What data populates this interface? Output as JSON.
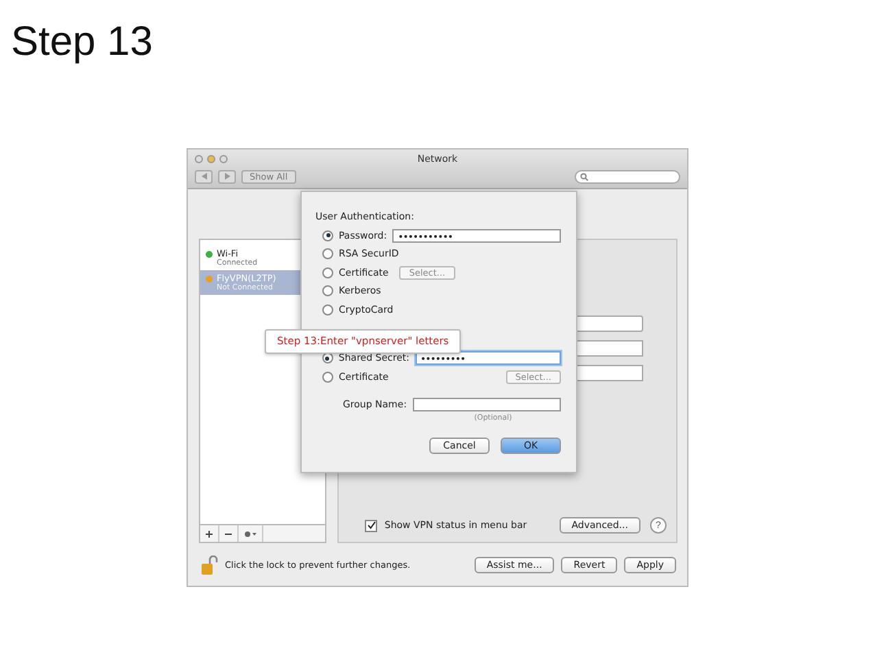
{
  "slide_title": "Step 13",
  "window": {
    "title": "Network",
    "show_all": "Show All"
  },
  "sidebar": {
    "items": [
      {
        "name": "Wi-Fi",
        "status": "Connected",
        "color": "#3cb043",
        "selected": false
      },
      {
        "name": "FlyVPN(L2TP)",
        "status": "Not Connected",
        "color": "#e8a020",
        "selected": true
      }
    ]
  },
  "vpn_status_checkbox": {
    "label": "Show VPN status in menu bar",
    "checked": true
  },
  "advanced_button": "Advanced...",
  "help_button": "?",
  "lock_text": "Click the lock to prevent further changes.",
  "footer_buttons": [
    "Assist me...",
    "Revert",
    "Apply"
  ],
  "sheet": {
    "heading": "User Authentication:",
    "groups": [
      [
        {
          "label": "Password:",
          "selected": true,
          "kind": "field",
          "value": "•••••••••••"
        },
        {
          "label": "RSA SecurID",
          "selected": false,
          "kind": "plain"
        },
        {
          "label": "Certificate",
          "selected": false,
          "kind": "button",
          "button": "Select..."
        },
        {
          "label": "Kerberos",
          "selected": false,
          "kind": "plain"
        },
        {
          "label": "CryptoCard",
          "selected": false,
          "kind": "plain"
        }
      ],
      [
        {
          "label": "Shared Secret:",
          "selected": true,
          "kind": "field",
          "value": "•••••••••"
        },
        {
          "label": "Certificate",
          "selected": false,
          "kind": "button",
          "button": "Select..."
        }
      ]
    ],
    "group_name": {
      "label": "Group Name:",
      "hint": "(Optional)"
    },
    "buttons": [
      {
        "label": "Cancel",
        "default": false
      },
      {
        "label": "OK",
        "default": true
      }
    ]
  },
  "callout": {
    "text": "Step 13:Enter \"vpnserver\" letters"
  }
}
